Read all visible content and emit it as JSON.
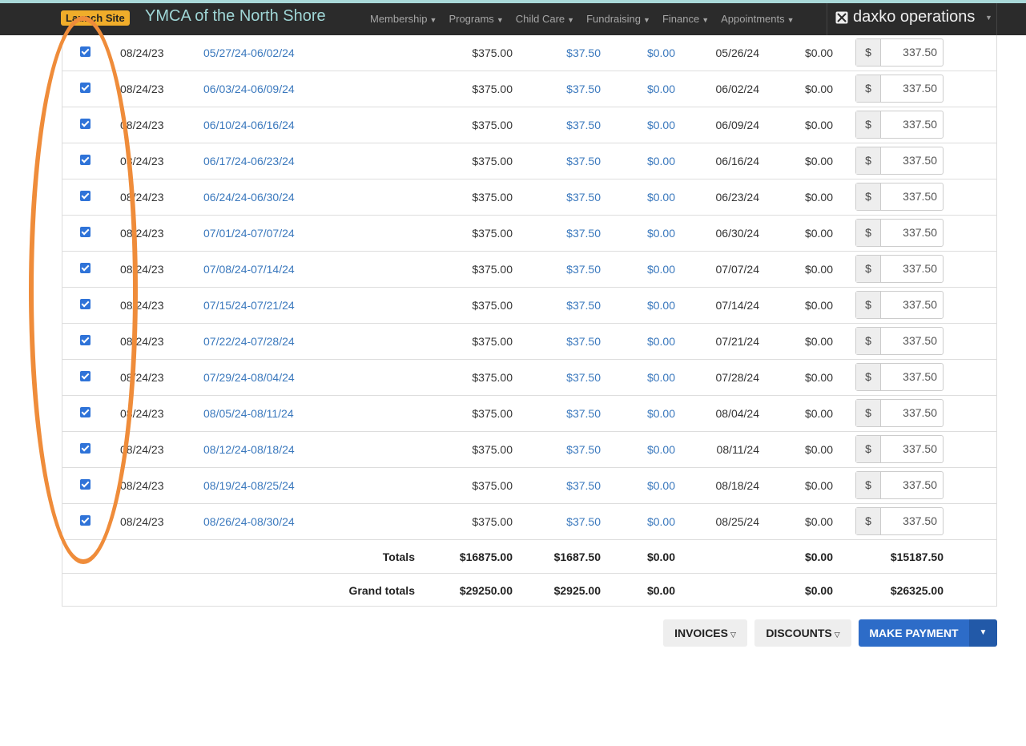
{
  "header": {
    "launch_label": "Launch Site",
    "site_title": "YMCA of the North Shore",
    "nav": [
      "Membership",
      "Programs",
      "Child Care",
      "Fundraising",
      "Finance",
      "Appointments"
    ],
    "brand": "daxko operations"
  },
  "rows": [
    {
      "date": "08/24/23",
      "period": "05/27/24-06/02/24",
      "amount": "$375.00",
      "discount": "$37.50",
      "adjust": "$0.00",
      "due": "05/26/24",
      "paid": "$0.00",
      "currency": "$",
      "payment": "337.50",
      "checked": true
    },
    {
      "date": "08/24/23",
      "period": "06/03/24-06/09/24",
      "amount": "$375.00",
      "discount": "$37.50",
      "adjust": "$0.00",
      "due": "06/02/24",
      "paid": "$0.00",
      "currency": "$",
      "payment": "337.50",
      "checked": true
    },
    {
      "date": "08/24/23",
      "period": "06/10/24-06/16/24",
      "amount": "$375.00",
      "discount": "$37.50",
      "adjust": "$0.00",
      "due": "06/09/24",
      "paid": "$0.00",
      "currency": "$",
      "payment": "337.50",
      "checked": true
    },
    {
      "date": "08/24/23",
      "period": "06/17/24-06/23/24",
      "amount": "$375.00",
      "discount": "$37.50",
      "adjust": "$0.00",
      "due": "06/16/24",
      "paid": "$0.00",
      "currency": "$",
      "payment": "337.50",
      "checked": true
    },
    {
      "date": "08/24/23",
      "period": "06/24/24-06/30/24",
      "amount": "$375.00",
      "discount": "$37.50",
      "adjust": "$0.00",
      "due": "06/23/24",
      "paid": "$0.00",
      "currency": "$",
      "payment": "337.50",
      "checked": true
    },
    {
      "date": "08/24/23",
      "period": "07/01/24-07/07/24",
      "amount": "$375.00",
      "discount": "$37.50",
      "adjust": "$0.00",
      "due": "06/30/24",
      "paid": "$0.00",
      "currency": "$",
      "payment": "337.50",
      "checked": true
    },
    {
      "date": "08/24/23",
      "period": "07/08/24-07/14/24",
      "amount": "$375.00",
      "discount": "$37.50",
      "adjust": "$0.00",
      "due": "07/07/24",
      "paid": "$0.00",
      "currency": "$",
      "payment": "337.50",
      "checked": true
    },
    {
      "date": "08/24/23",
      "period": "07/15/24-07/21/24",
      "amount": "$375.00",
      "discount": "$37.50",
      "adjust": "$0.00",
      "due": "07/14/24",
      "paid": "$0.00",
      "currency": "$",
      "payment": "337.50",
      "checked": true
    },
    {
      "date": "08/24/23",
      "period": "07/22/24-07/28/24",
      "amount": "$375.00",
      "discount": "$37.50",
      "adjust": "$0.00",
      "due": "07/21/24",
      "paid": "$0.00",
      "currency": "$",
      "payment": "337.50",
      "checked": true
    },
    {
      "date": "08/24/23",
      "period": "07/29/24-08/04/24",
      "amount": "$375.00",
      "discount": "$37.50",
      "adjust": "$0.00",
      "due": "07/28/24",
      "paid": "$0.00",
      "currency": "$",
      "payment": "337.50",
      "checked": true
    },
    {
      "date": "08/24/23",
      "period": "08/05/24-08/11/24",
      "amount": "$375.00",
      "discount": "$37.50",
      "adjust": "$0.00",
      "due": "08/04/24",
      "paid": "$0.00",
      "currency": "$",
      "payment": "337.50",
      "checked": true
    },
    {
      "date": "08/24/23",
      "period": "08/12/24-08/18/24",
      "amount": "$375.00",
      "discount": "$37.50",
      "adjust": "$0.00",
      "due": "08/11/24",
      "paid": "$0.00",
      "currency": "$",
      "payment": "337.50",
      "checked": true
    },
    {
      "date": "08/24/23",
      "period": "08/19/24-08/25/24",
      "amount": "$375.00",
      "discount": "$37.50",
      "adjust": "$0.00",
      "due": "08/18/24",
      "paid": "$0.00",
      "currency": "$",
      "payment": "337.50",
      "checked": true
    },
    {
      "date": "08/24/23",
      "period": "08/26/24-08/30/24",
      "amount": "$375.00",
      "discount": "$37.50",
      "adjust": "$0.00",
      "due": "08/25/24",
      "paid": "$0.00",
      "currency": "$",
      "payment": "337.50",
      "checked": true
    }
  ],
  "totals": {
    "label": "Totals",
    "amount": "$16875.00",
    "discount": "$1687.50",
    "adjust": "$0.00",
    "paid": "$0.00",
    "payment": "$15187.50"
  },
  "grand_totals": {
    "label": "Grand totals",
    "amount": "$29250.00",
    "discount": "$2925.00",
    "adjust": "$0.00",
    "paid": "$0.00",
    "payment": "$26325.00"
  },
  "buttons": {
    "invoices": "INVOICES",
    "discounts": "DISCOUNTS",
    "make_payment": "MAKE PAYMENT"
  },
  "colors": {
    "accent": "#2d6cc8",
    "annotation": "#ef8c3a",
    "link": "#3a78bd",
    "launch_badge": "#f0ad2a"
  }
}
